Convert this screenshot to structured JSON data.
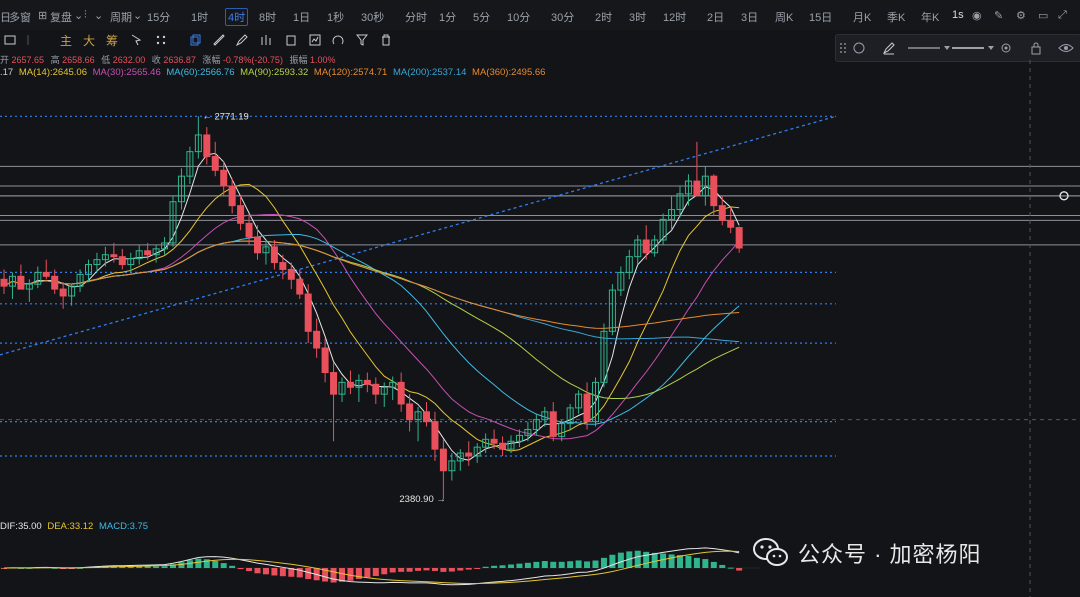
{
  "topbar": {
    "app_prefix": "日",
    "multi_window": "多窗",
    "adjust": "复盘",
    "period_label": "周期",
    "timeframes": [
      "15分",
      "1时",
      "4时",
      "8时",
      "1日",
      "1秒",
      "30秒",
      "分时",
      "1分",
      "5分",
      "10分",
      "30分",
      "2时",
      "3时",
      "12时",
      "2日",
      "3日",
      "周K",
      "15日",
      "月K",
      "季K",
      "年K"
    ],
    "active_timeframe": "4时",
    "right_interval": "1s"
  },
  "toolbar": {
    "main": "主",
    "big": "大",
    "chip": "筹"
  },
  "ohlc": {
    "open_label": "开",
    "open": "2657.65",
    "high_label": "高",
    "high": "2658.66",
    "low_label": "低",
    "low": "2632.00",
    "close_label": "收",
    "close": "2636.87",
    "change_label": "涨幅",
    "change": "-0.78%(-20.75)",
    "amplitude_label": "振幅",
    "amplitude": "1.00%"
  },
  "ma": {
    "first": ".17",
    "ma14": "MA(14):2645.06",
    "ma30": "MA(30):2565.46",
    "ma60": "MA(60):2566.76",
    "ma90": "MA(90):2593.32",
    "ma120": "MA(120):2574.71",
    "ma200": "MA(200):2537.14",
    "ma360": "MA(360):2495.66"
  },
  "macd": {
    "dif": "DIF:35.00",
    "dea": "DEA:33.12",
    "macd": "MACD:3.75"
  },
  "chart_labels": {
    "high_marker": "2771.19",
    "low_marker": "2380.90"
  },
  "watermark": {
    "text": "公众号 · 加密杨阳"
  },
  "colors": {
    "up": "#2fb58d",
    "down": "#e9505c",
    "ma14": "#e6e6e6",
    "ma30": "#e6c531",
    "ma60": "#c64fb5",
    "ma90": "#3fbbe6",
    "ma120": "#b0d24a",
    "ma200": "#3aa6d6",
    "ma360": "#e88a2e",
    "level_line": "#2f7df0",
    "accent": "#3b7de9"
  },
  "chart_data": {
    "type": "candlestick",
    "timeframe": "4时",
    "candles": [
      [
        2605,
        2615,
        2590,
        2598
      ],
      [
        2598,
        2612,
        2585,
        2608
      ],
      [
        2608,
        2620,
        2600,
        2595
      ],
      [
        2595,
        2605,
        2582,
        2600
      ],
      [
        2600,
        2618,
        2596,
        2612
      ],
      [
        2612,
        2625,
        2605,
        2608
      ],
      [
        2608,
        2615,
        2590,
        2595
      ],
      [
        2595,
        2602,
        2575,
        2588
      ],
      [
        2588,
        2600,
        2578,
        2598
      ],
      [
        2598,
        2615,
        2592,
        2610
      ],
      [
        2610,
        2625,
        2602,
        2620
      ],
      [
        2620,
        2632,
        2612,
        2625
      ],
      [
        2625,
        2638,
        2618,
        2630
      ],
      [
        2630,
        2642,
        2622,
        2628
      ],
      [
        2628,
        2636,
        2615,
        2620
      ],
      [
        2620,
        2632,
        2612,
        2626
      ],
      [
        2626,
        2640,
        2620,
        2634
      ],
      [
        2634,
        2642,
        2625,
        2630
      ],
      [
        2630,
        2640,
        2622,
        2636
      ],
      [
        2636,
        2648,
        2630,
        2642
      ],
      [
        2642,
        2690,
        2638,
        2684
      ],
      [
        2684,
        2718,
        2676,
        2710
      ],
      [
        2710,
        2740,
        2702,
        2735
      ],
      [
        2735,
        2771,
        2728,
        2752
      ],
      [
        2752,
        2760,
        2722,
        2730
      ],
      [
        2730,
        2745,
        2710,
        2716
      ],
      [
        2716,
        2725,
        2690,
        2700
      ],
      [
        2700,
        2708,
        2672,
        2680
      ],
      [
        2680,
        2690,
        2655,
        2662
      ],
      [
        2662,
        2672,
        2640,
        2648
      ],
      [
        2648,
        2660,
        2625,
        2632
      ],
      [
        2632,
        2645,
        2620,
        2638
      ],
      [
        2638,
        2645,
        2615,
        2622
      ],
      [
        2622,
        2630,
        2605,
        2615
      ],
      [
        2615,
        2622,
        2595,
        2605
      ],
      [
        2605,
        2615,
        2585,
        2590
      ],
      [
        2590,
        2600,
        2540,
        2552
      ],
      [
        2552,
        2565,
        2525,
        2535
      ],
      [
        2535,
        2545,
        2500,
        2510
      ],
      [
        2510,
        2520,
        2440,
        2488
      ],
      [
        2488,
        2505,
        2480,
        2500
      ],
      [
        2500,
        2512,
        2488,
        2495
      ],
      [
        2495,
        2508,
        2480,
        2502
      ],
      [
        2502,
        2510,
        2490,
        2498
      ],
      [
        2498,
        2505,
        2478,
        2488
      ],
      [
        2488,
        2500,
        2475,
        2495
      ],
      [
        2495,
        2506,
        2482,
        2500
      ],
      [
        2500,
        2510,
        2470,
        2478
      ],
      [
        2478,
        2488,
        2450,
        2462
      ],
      [
        2462,
        2475,
        2440,
        2470
      ],
      [
        2470,
        2480,
        2455,
        2460
      ],
      [
        2460,
        2470,
        2420,
        2432
      ],
      [
        2432,
        2442,
        2381,
        2410
      ],
      [
        2410,
        2428,
        2400,
        2420
      ],
      [
        2420,
        2432,
        2410,
        2428
      ],
      [
        2428,
        2440,
        2415,
        2425
      ],
      [
        2425,
        2438,
        2418,
        2434
      ],
      [
        2434,
        2448,
        2428,
        2442
      ],
      [
        2442,
        2452,
        2432,
        2438
      ],
      [
        2438,
        2445,
        2425,
        2432
      ],
      [
        2432,
        2446,
        2428,
        2440
      ],
      [
        2440,
        2452,
        2434,
        2446
      ],
      [
        2446,
        2460,
        2440,
        2452
      ],
      [
        2452,
        2468,
        2446,
        2462
      ],
      [
        2462,
        2475,
        2455,
        2470
      ],
      [
        2470,
        2480,
        2440,
        2445
      ],
      [
        2445,
        2462,
        2440,
        2458
      ],
      [
        2458,
        2478,
        2452,
        2474
      ],
      [
        2474,
        2492,
        2468,
        2488
      ],
      [
        2488,
        2500,
        2452,
        2460
      ],
      [
        2460,
        2505,
        2455,
        2500
      ],
      [
        2500,
        2560,
        2495,
        2552
      ],
      [
        2552,
        2600,
        2548,
        2594
      ],
      [
        2594,
        2618,
        2588,
        2612
      ],
      [
        2612,
        2635,
        2605,
        2628
      ],
      [
        2628,
        2650,
        2620,
        2645
      ],
      [
        2645,
        2660,
        2625,
        2632
      ],
      [
        2632,
        2650,
        2628,
        2645
      ],
      [
        2645,
        2672,
        2640,
        2666
      ],
      [
        2666,
        2690,
        2655,
        2676
      ],
      [
        2676,
        2700,
        2668,
        2692
      ],
      [
        2692,
        2712,
        2680,
        2705
      ],
      [
        2705,
        2745,
        2698,
        2690
      ],
      [
        2690,
        2720,
        2680,
        2710
      ],
      [
        2710,
        2712,
        2670,
        2680
      ],
      [
        2680,
        2690,
        2660,
        2665
      ],
      [
        2665,
        2678,
        2652,
        2658
      ],
      [
        2657.65,
        2658.66,
        2632,
        2636.87
      ]
    ],
    "y_range": [
      2370,
      2810
    ],
    "horizontal_levels": [
      2771,
      2700,
      2690,
      2690,
      2670,
      2612,
      2540,
      2425
    ],
    "ma_lines": [
      "MA14",
      "MA30",
      "MA60",
      "MA90",
      "MA120",
      "MA200",
      "MA360"
    ],
    "macd": {
      "dif": 35.0,
      "dea": 33.12,
      "macd": 3.75
    }
  }
}
